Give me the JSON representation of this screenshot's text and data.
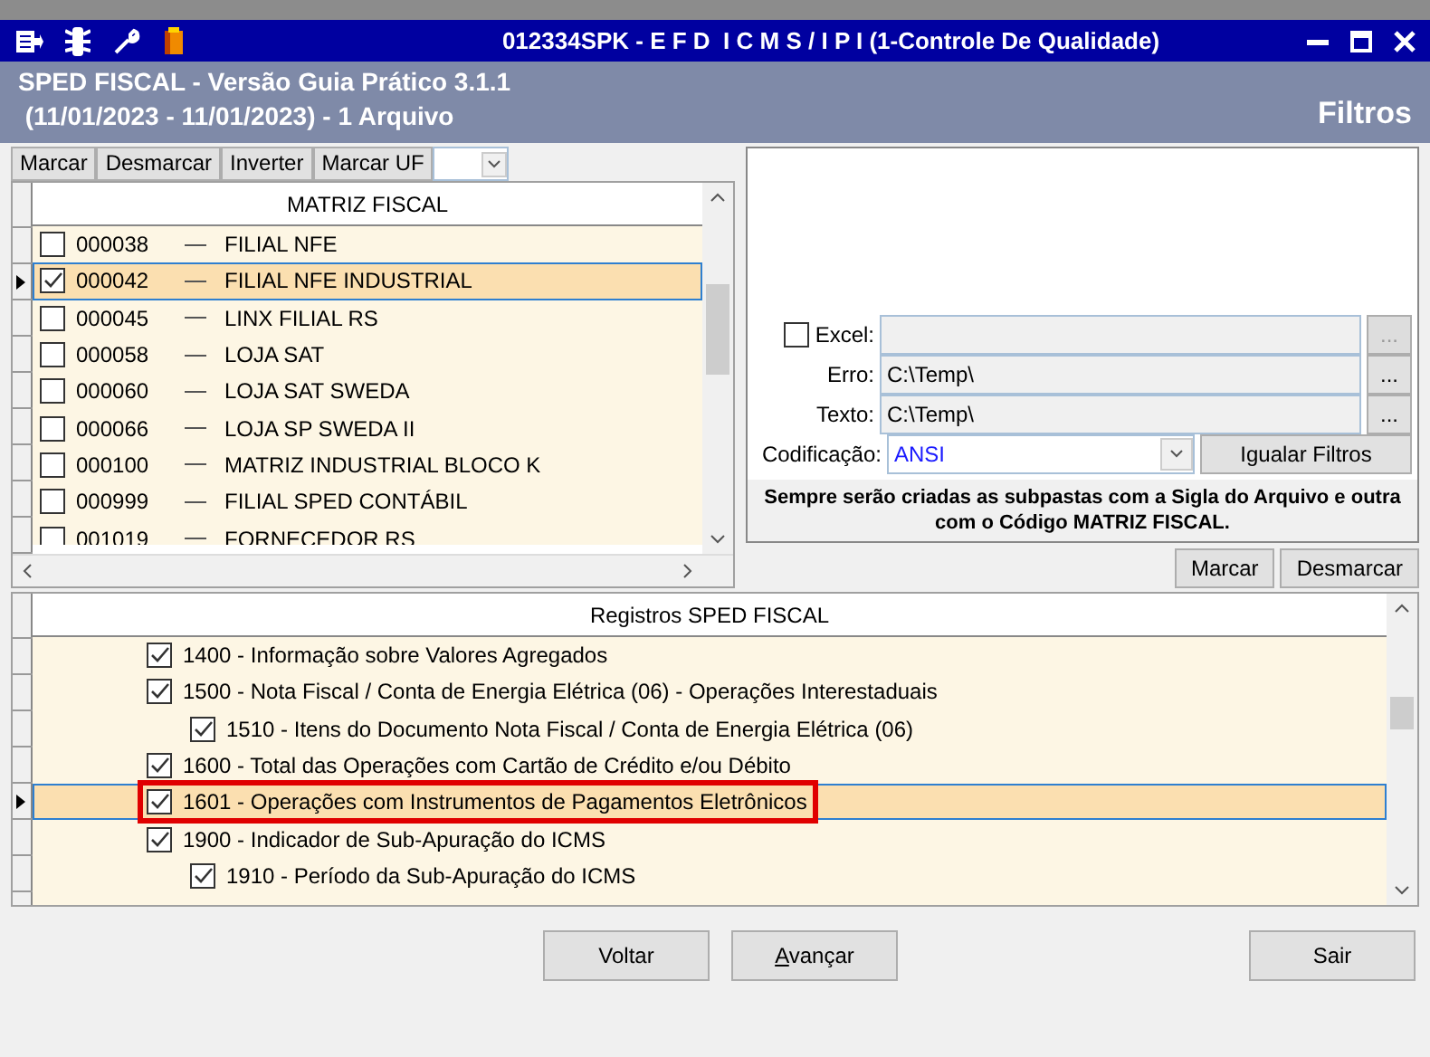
{
  "title_bar": {
    "title": "012334SPK - E F D  I C M S / I P I (1-Controle De Qualidade)"
  },
  "header": {
    "line1": "SPED FISCAL - Versão Guia Prático 3.1.1",
    "line2": " (11/01/2023 - 11/01/2023) - 1 Arquivo",
    "section": "Filtros"
  },
  "matriz_toolbar": {
    "buttons": [
      "Marcar",
      "Desmarcar",
      "Inverter",
      "Marcar UF"
    ]
  },
  "matriz_grid": {
    "column": "MATRIZ FISCAL",
    "rows": [
      {
        "code": "000038",
        "name": "FILIAL NFE",
        "checked": false,
        "selected": false
      },
      {
        "code": "000042",
        "name": "FILIAL NFE INDUSTRIAL",
        "checked": true,
        "selected": true
      },
      {
        "code": "000045",
        "name": "LINX FILIAL RS",
        "checked": false,
        "selected": false
      },
      {
        "code": "000058",
        "name": "LOJA SAT",
        "checked": false,
        "selected": false
      },
      {
        "code": "000060",
        "name": "LOJA SAT SWEDA",
        "checked": false,
        "selected": false
      },
      {
        "code": "000066",
        "name": "LOJA SP SWEDA II",
        "checked": false,
        "selected": false
      },
      {
        "code": "000100",
        "name": "MATRIZ INDUSTRIAL BLOCO K",
        "checked": false,
        "selected": false
      },
      {
        "code": "000999",
        "name": "FILIAL SPED CONTÁBIL",
        "checked": false,
        "selected": false
      },
      {
        "code": "001019",
        "name": "FORNECEDOR RS",
        "checked": false,
        "selected": false
      }
    ]
  },
  "export": {
    "fields": [
      {
        "kind": "checkbox",
        "label": "Excel:",
        "checked": false,
        "browse": "...",
        "disabled": true
      },
      {
        "kind": "path",
        "label": "Erro:",
        "value": "C:\\Temp\\",
        "browse": "...",
        "disabled": false
      },
      {
        "kind": "path",
        "label": "Texto:",
        "value": "C:\\Temp\\",
        "browse": "...",
        "disabled": false
      }
    ],
    "encoding": {
      "label": "Codificação:",
      "value": "ANSI"
    },
    "equalize_button": "Igualar Filtros",
    "note": "Sempre serão criadas as subpastas com a Sigla do Arquivo e outra com o Código MATRIZ FISCAL."
  },
  "registros_toolbar": [
    "Marcar",
    "Desmarcar"
  ],
  "registros_grid": {
    "column": "Registros SPED FISCAL",
    "rows": [
      {
        "label": "1400 - Informação sobre Valores Agregados",
        "checked": true,
        "selected": false,
        "annotated": false
      },
      {
        "label": "1500 - Nota Fiscal / Conta de Energia Elétrica (06) - Operações Interestaduais",
        "checked": true,
        "selected": false,
        "annotated": false,
        "children": [
          {
            "label": "1510 - Itens do Documento Nota Fiscal / Conta de Energia Elétrica (06)",
            "checked": true,
            "selected": false,
            "annotated": false
          }
        ]
      },
      {
        "label": "1600 - Total das Operações com Cartão de Crédito e/ou Débito",
        "checked": true,
        "selected": false,
        "annotated": false
      },
      {
        "label": "1601 - Operações com Instrumentos de Pagamentos Eletrônicos",
        "checked": true,
        "selected": true,
        "annotated": true
      },
      {
        "label": "1900 - Indicador de Sub-Apuração do ICMS",
        "checked": true,
        "selected": false,
        "annotated": false,
        "children": [
          {
            "label": "1910 - Período da Sub-Apuração do ICMS",
            "checked": true,
            "selected": false,
            "annotated": false
          }
        ]
      }
    ]
  },
  "footer_buttons": [
    {
      "label": "Voltar",
      "mnemonic": false
    },
    {
      "label": "Avançar",
      "mnemonic": true
    },
    {
      "label": "Sair",
      "mnemonic": false
    }
  ]
}
